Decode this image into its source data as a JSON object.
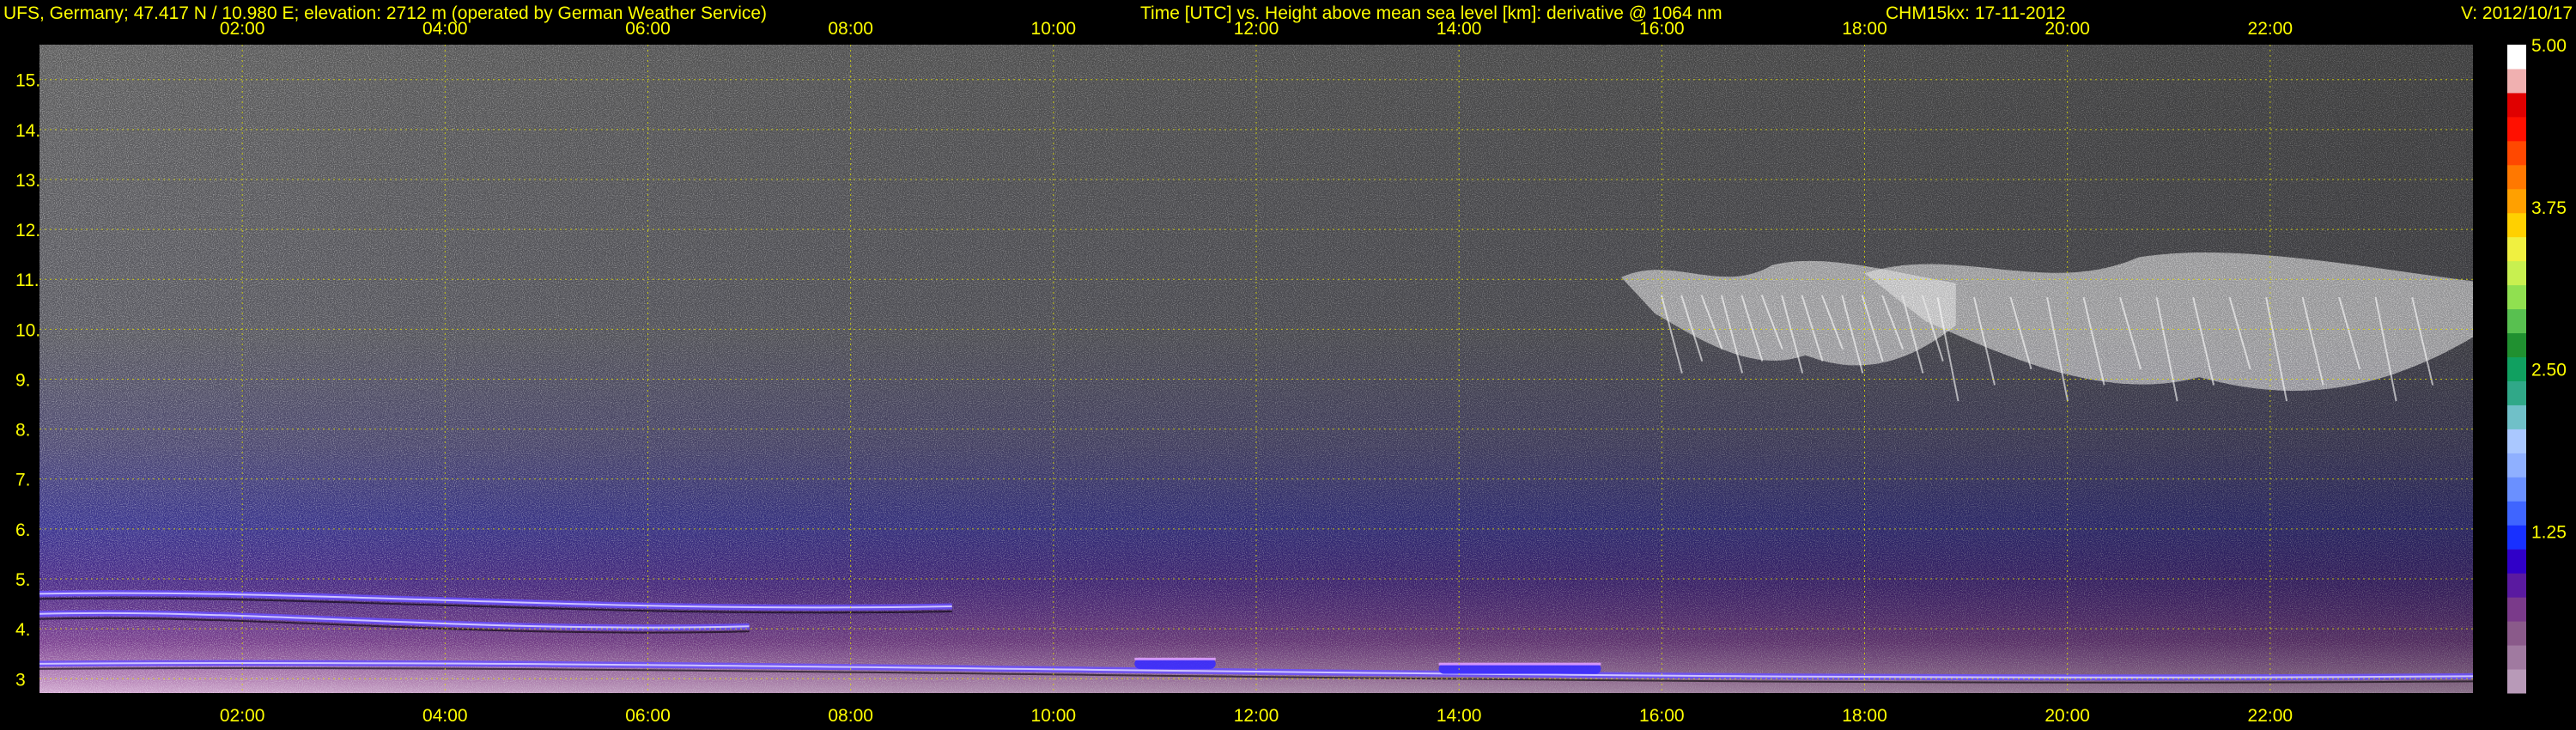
{
  "header": {
    "site": "UFS, Germany; 47.417 N / 10.980 E; elevation: 2712 m  (operated by German Weather Service)",
    "title": "Time [UTC] vs. Height above mean sea level [km]: derivative @ 1064 nm",
    "instrument": "CHM15kx: 17-11-2012",
    "version": "V: 2012/10/17"
  },
  "colors": {
    "text": "#ffff00",
    "grid": "#e0e000",
    "background": "#000000"
  },
  "chart_data": {
    "type": "heatmap",
    "title": "Time [UTC] vs. Height above mean sea level [km]: derivative @ 1064 nm",
    "x_ticks": [
      "02:00",
      "04:00",
      "06:00",
      "08:00",
      "10:00",
      "12:00",
      "14:00",
      "16:00",
      "18:00",
      "20:00",
      "22:00"
    ],
    "x_tick_values": [
      2,
      4,
      6,
      8,
      10,
      12,
      14,
      16,
      18,
      20,
      22
    ],
    "xlim": [
      0,
      24
    ],
    "y_ticks": [
      "3",
      "4.",
      "5.",
      "6.",
      "7.",
      "8.",
      "9.",
      "10.",
      "11.",
      "12.",
      "13.",
      "14.",
      "15."
    ],
    "y_tick_values": [
      3,
      4,
      5,
      6,
      7,
      8,
      9,
      10,
      11,
      12,
      13,
      14,
      15
    ],
    "ylim": [
      2.712,
      15.7
    ],
    "grid": true,
    "colorbar": {
      "labels": [
        "5.00",
        "3.75",
        "2.50",
        "1.25"
      ],
      "label_values": [
        5.0,
        3.75,
        2.5,
        1.25
      ],
      "range": [
        0,
        5.0
      ],
      "colors": [
        "#b89ab8",
        "#a07aa0",
        "#8a5a8a",
        "#7a3a8a",
        "#5a1aa0",
        "#3000c8",
        "#1830ff",
        "#3f65ff",
        "#6a90ff",
        "#8fb0ff",
        "#aac8ff",
        "#70c0c8",
        "#30a888",
        "#10a060",
        "#209030",
        "#58c050",
        "#90e050",
        "#c8f050",
        "#f0f040",
        "#ffd000",
        "#ffa000",
        "#ff7800",
        "#ff4800",
        "#ff1000",
        "#e00000",
        "#f0b0b0",
        "#ffffff"
      ]
    },
    "features": [
      {
        "kind": "layer",
        "hour_start": 0,
        "hour_end": 9,
        "height_start_km": 4.7,
        "height_end_km": 4.45
      },
      {
        "kind": "layer",
        "hour_start": 0,
        "hour_end": 7,
        "height_start_km": 4.3,
        "height_end_km": 4.05
      },
      {
        "kind": "layer",
        "hour_start": 0,
        "hour_end": 24,
        "height_start_km": 3.3,
        "height_end_km": 3.05
      },
      {
        "kind": "patch",
        "hour_start": 13.8,
        "hour_end": 15.4,
        "height_km": 3.2
      },
      {
        "kind": "patch",
        "hour_start": 10.8,
        "hour_end": 11.6,
        "height_km": 3.3
      },
      {
        "kind": "cloud",
        "hour_start": 15.6,
        "hour_end": 18.9,
        "height_bottom_km": 9.0,
        "height_top_km": 11.4
      },
      {
        "kind": "cloud",
        "hour_start": 18.0,
        "hour_end": 24,
        "height_bottom_km": 8.4,
        "height_top_km": 11.6
      }
    ]
  }
}
